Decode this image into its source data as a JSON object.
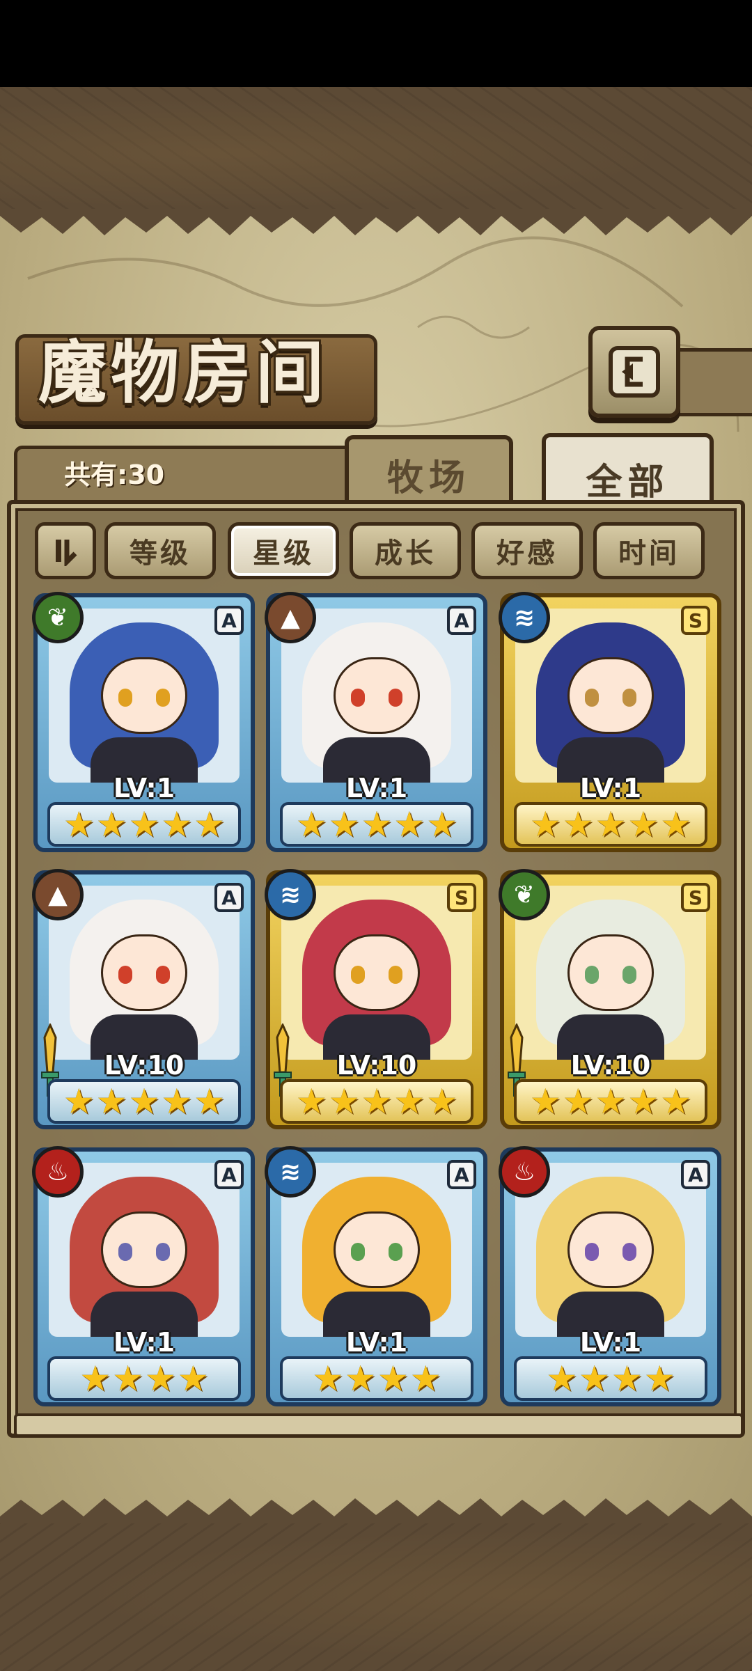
{
  "title": "魔物房间",
  "count_label": "共有:30",
  "tabs": {
    "ranch": "牧场",
    "all": "全部"
  },
  "sort": {
    "buttons": [
      "等级",
      "星级",
      "成长",
      "好感",
      "时间"
    ],
    "active": "星级"
  },
  "cards": [
    {
      "level": "LV:1",
      "rarity": "A",
      "element": "plant-icon",
      "stars": 5,
      "hair": "#3b5fb5",
      "eye": "#e0a020"
    },
    {
      "level": "LV:1",
      "rarity": "A",
      "element": "earth-icon",
      "stars": 5,
      "hair": "#f4f1ee",
      "eye": "#d0402a"
    },
    {
      "level": "LV:1",
      "rarity": "S",
      "element": "water-icon",
      "stars": 5,
      "hair": "#2e3a8a",
      "eye": "#c09040"
    },
    {
      "level": "LV:10",
      "rarity": "A",
      "element": "earth-icon",
      "stars": 5,
      "hair": "#f4f1ee",
      "eye": "#d0402a"
    },
    {
      "level": "LV:10",
      "rarity": "S",
      "element": "water-icon",
      "stars": 5,
      "hair": "#c23a4a",
      "eye": "#e0a020"
    },
    {
      "level": "LV:10",
      "rarity": "S",
      "element": "plant-icon",
      "stars": 5,
      "hair": "#e8ece0",
      "eye": "#6aa56a"
    },
    {
      "level": "LV:1",
      "rarity": "A",
      "element": "fire-icon",
      "stars": 4,
      "hair": "#c24a40",
      "eye": "#6a6ab0"
    },
    {
      "level": "LV:1",
      "rarity": "A",
      "element": "water-icon",
      "stars": 4,
      "hair": "#f0b030",
      "eye": "#5aa050"
    },
    {
      "level": "LV:1",
      "rarity": "A",
      "element": "fire-icon",
      "stars": 4,
      "hair": "#f0d070",
      "eye": "#7a5ab0"
    }
  ]
}
